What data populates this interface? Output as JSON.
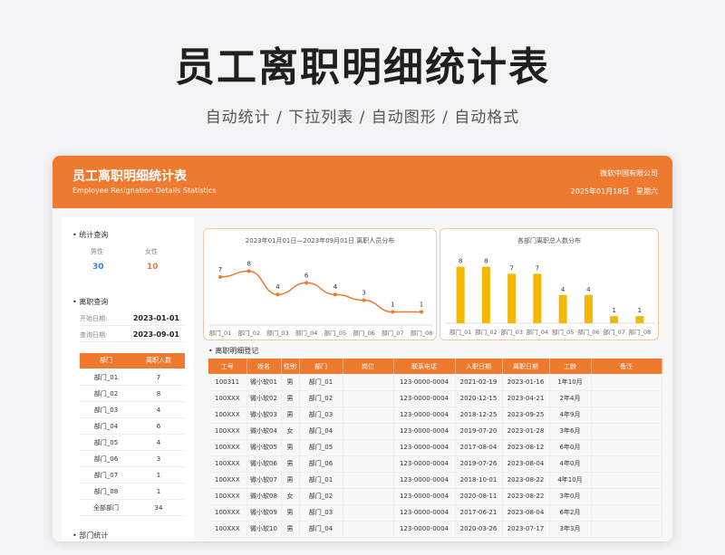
{
  "hero": {
    "title": "员工离职明细统计表",
    "subtitle": "自动统计 / 下拉列表 / 自动图形 / 自动格式"
  },
  "header": {
    "title": "员工离职明细统计表",
    "subtitle": "Employee Resignation Details Statistics",
    "company": "微软中国有限公司",
    "date": "2025年01月18日",
    "weekday": "星期六"
  },
  "stats": {
    "section_title": "统计查询",
    "male_label": "男性",
    "female_label": "女性",
    "male_count": "30",
    "female_count": "10",
    "male_color": "#3b7ddd",
    "female_color": "#ee7a30"
  },
  "query": {
    "section_title": "离职查询",
    "start_label": "开始日期:",
    "start_value": "2023-01-01",
    "end_label": "查询日期:",
    "end_value": "2023-09-01",
    "dept_header": "部门",
    "count_header": "离职人数",
    "rows": [
      {
        "dept": "部门_01",
        "count": "7"
      },
      {
        "dept": "部门_02",
        "count": "8"
      },
      {
        "dept": "部门_03",
        "count": "4"
      },
      {
        "dept": "部门_04",
        "count": "6"
      },
      {
        "dept": "部门_05",
        "count": "4"
      },
      {
        "dept": "部门_06",
        "count": "3"
      },
      {
        "dept": "部门_07",
        "count": "1"
      },
      {
        "dept": "部门_08",
        "count": "1"
      },
      {
        "dept": "全部部门",
        "count": "34"
      }
    ]
  },
  "dept_stats": {
    "section_title": "部门统计"
  },
  "chart_data": [
    {
      "type": "line",
      "title": "2023年01月01日—2023年09月01日 离职人员分布",
      "categories": [
        "部门_01",
        "部门_02",
        "部门_03",
        "部门_04",
        "部门_05",
        "部门_06",
        "部门_07",
        "部门_08"
      ],
      "values": [
        7,
        8,
        4,
        6,
        4,
        3,
        1,
        1
      ],
      "color": "#ee7a30"
    },
    {
      "type": "bar",
      "title": "各部门离职总人数分布",
      "categories": [
        "部门_01",
        "部门_02",
        "部门_03",
        "部门_04",
        "部门_05",
        "部门_06",
        "部门_07",
        "部门_08"
      ],
      "values": [
        8,
        8,
        7,
        7,
        4,
        4,
        1,
        1
      ],
      "color": "#f5b800"
    }
  ],
  "table": {
    "section_title": "离职明细登记",
    "columns": [
      "工号",
      "姓名",
      "性别",
      "部门",
      "岗位",
      "联系电话",
      "入职日期",
      "离职日期",
      "工龄",
      "备注"
    ],
    "rows": [
      [
        "100311",
        "微小软01",
        "男",
        "部门_01",
        "",
        "123-0000-0004",
        "2021-02-19",
        "2023-01-16",
        "1年10月",
        ""
      ],
      [
        "100XXX",
        "微小软02",
        "男",
        "部门_02",
        "",
        "123-0000-0004",
        "2020-12-15",
        "2023-04-21",
        "2年4月",
        ""
      ],
      [
        "100XXX",
        "微小软03",
        "男",
        "部门_03",
        "",
        "123-0000-0004",
        "2018-12-25",
        "2023-09-25",
        "4年9月",
        ""
      ],
      [
        "100XXX",
        "微小软04",
        "女",
        "部门_04",
        "",
        "123-0000-0004",
        "2019-07-20",
        "2023-01-28",
        "3年6月",
        ""
      ],
      [
        "100XXX",
        "微小软05",
        "男",
        "部门_05",
        "",
        "123-0000-0004",
        "2017-08-04",
        "2023-08-12",
        "6年0月",
        ""
      ],
      [
        "100XXX",
        "微小软06",
        "男",
        "部门_06",
        "",
        "123-0000-0004",
        "2019-07-26",
        "2023-08-04",
        "4年0月",
        ""
      ],
      [
        "100XXX",
        "微小软07",
        "男",
        "部门_01",
        "",
        "123-0000-0004",
        "2018-10-01",
        "2023-08-22",
        "4年10月",
        ""
      ],
      [
        "100XXX",
        "微小软08",
        "女",
        "部门_02",
        "",
        "123-0000-0004",
        "2020-08-11",
        "2023-08-22",
        "3年0月",
        ""
      ],
      [
        "100XXX",
        "微小软09",
        "男",
        "部门_03",
        "",
        "123-0000-0004",
        "2017-06-21",
        "2023-08-04",
        "6年2月",
        ""
      ],
      [
        "100XXX",
        "微小软10",
        "男",
        "部门_04",
        "",
        "123-0000-0004",
        "2020-03-26",
        "2023-07-17",
        "3年3月",
        ""
      ]
    ]
  }
}
